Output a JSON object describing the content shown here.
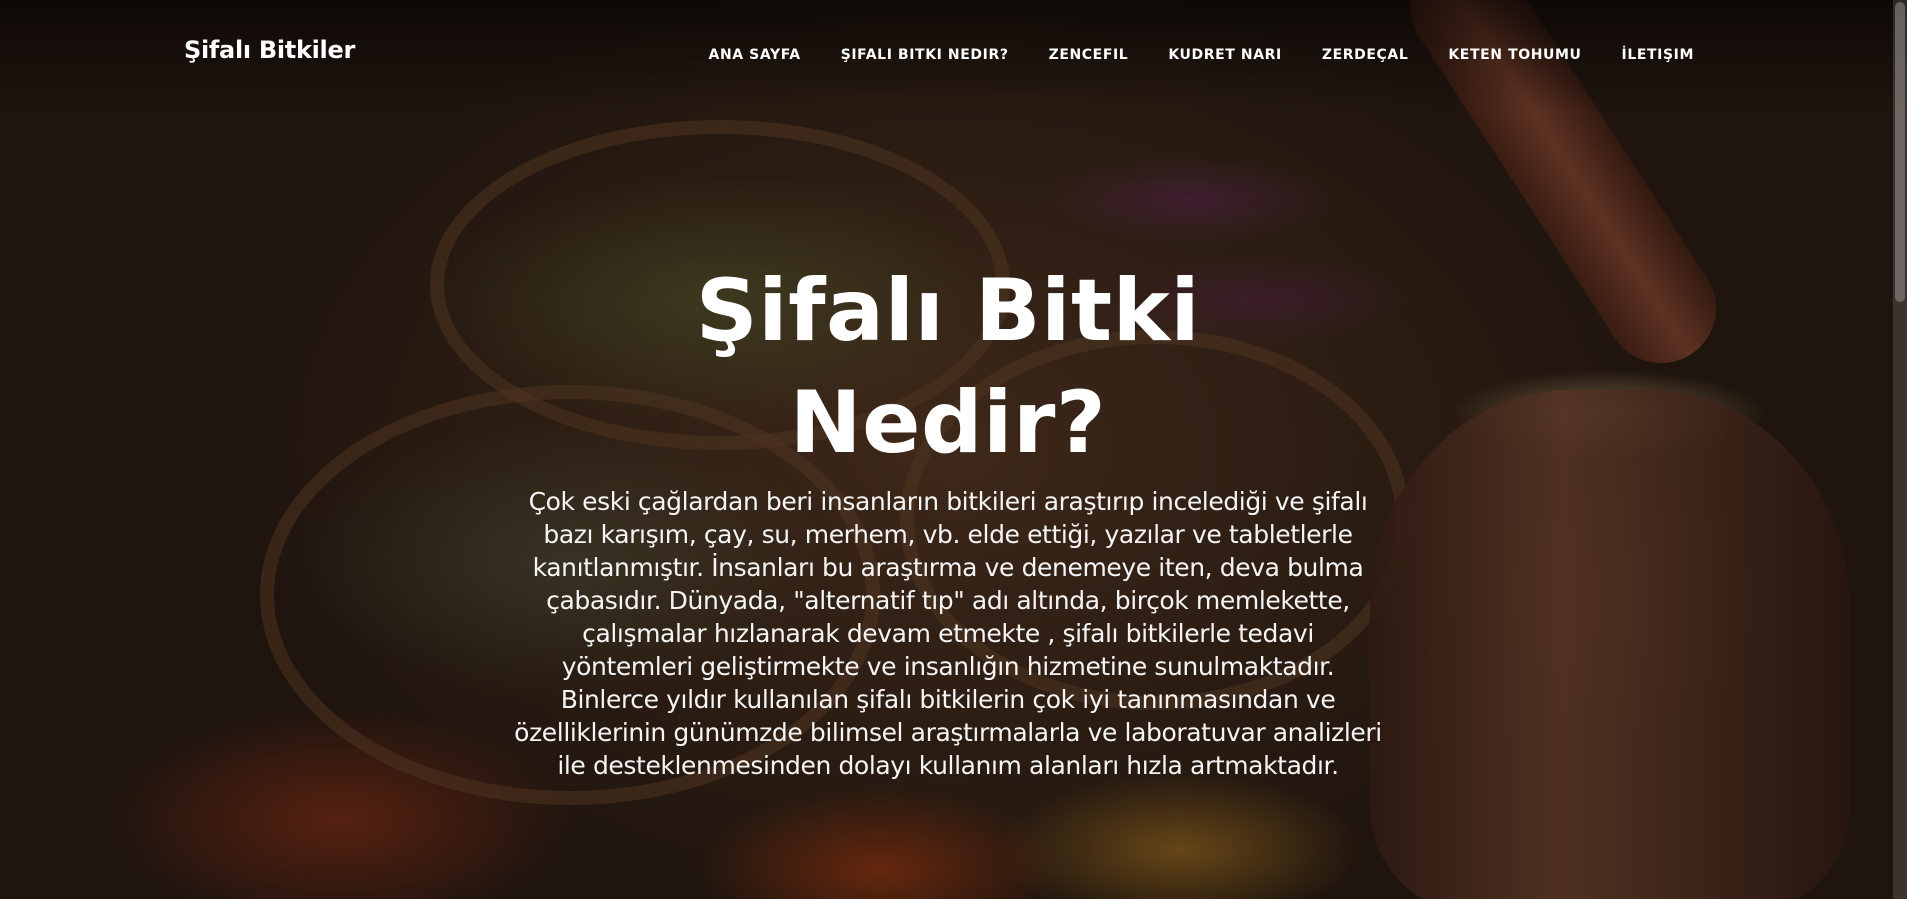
{
  "navbar": {
    "brand": "Şifalı Bitkiler",
    "items": [
      {
        "label": "ANA SAYFA"
      },
      {
        "label": "ŞIFALI BITKI NEDIR?"
      },
      {
        "label": "ZENCEFIL"
      },
      {
        "label": "KUDRET NARI"
      },
      {
        "label": "ZERDEÇAL"
      },
      {
        "label": "KETEN TOHUMU"
      },
      {
        "label": "İLETIŞIM"
      }
    ]
  },
  "hero": {
    "title": "Şifalı Bitki Nedir?",
    "body": "Çok eski çağlardan beri insanların bitkileri araştırıp incelediği ve şifalı bazı karışım, çay, su, merhem, vb. elde ettiği, yazılar ve tabletlerle kanıtlanmıştır. İnsanları bu araştırma ve denemeye iten, deva bulma çabasıdır. Dünyada, \"alternatif tıp\" adı altında, birçok memlekette, çalışmalar hızlanarak devam etmekte , şifalı bitkilerle tedavi yöntemleri geliştirmekte ve insanlığın hizmetine sunulmaktadır. Binlerce yıldır kullanılan şifalı bitkilerin çok iyi tanınmasından ve özelliklerinin günümzde bilimsel araştırmalarla ve laboratuvar analizleri ile desteklenmesinden dolayı kullanım alanları hızla artmaktadır."
  }
}
